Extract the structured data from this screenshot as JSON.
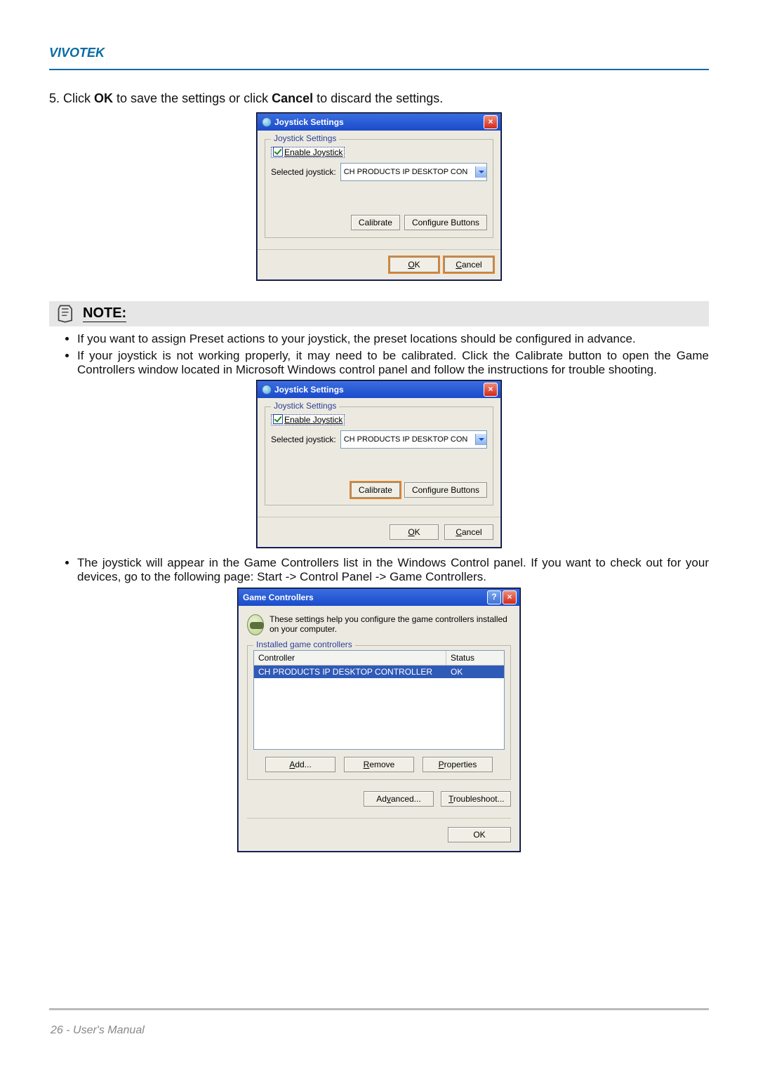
{
  "brand": "VIVOTEK",
  "step": {
    "num": "5.",
    "prefix": "Click ",
    "ok": "OK",
    "mid": " to save the settings or click ",
    "cancel": "Cancel",
    "suffix": " to discard the settings."
  },
  "jsDialog": {
    "title": "Joystick Settings",
    "legend": "Joystick Settings",
    "enableLabel": "Enable Joystick",
    "selectedLabel": "Selected joystick:",
    "selectedValue": "CH PRODUCTS IP DESKTOP CON",
    "calibrate": "Calibrate",
    "configure": "Configure Buttons",
    "ok": "OK",
    "cancel": "Cancel"
  },
  "note": {
    "heading": "NOTE:",
    "bullet1": "If you want to assign Preset actions to your joystick, the preset locations should be configured in advance.",
    "bullet2": "If your joystick is not working properly, it may need to be calibrated. Click the Calibrate button to open the Game Controllers window located in Microsoft Windows control panel and follow the instructions for trouble shooting.",
    "bullet3": "The joystick will appear in the Game Controllers list in the Windows Control panel. If you want to check out for your devices, go to the following page: Start -> Control Panel -> Game Controllers."
  },
  "gc": {
    "title": "Game Controllers",
    "desc": "These settings help you configure the game controllers installed on your computer.",
    "legend": "Installed game controllers",
    "colController": "Controller",
    "colStatus": "Status",
    "rowName": "CH PRODUCTS IP DESKTOP CONTROLLER",
    "rowStatus": "OK",
    "add": "Add...",
    "remove": "Remove",
    "properties": "Properties",
    "advanced": "Advanced...",
    "troubleshoot": "Troubleshoot...",
    "ok": "OK"
  },
  "footer": "26 - User's Manual"
}
